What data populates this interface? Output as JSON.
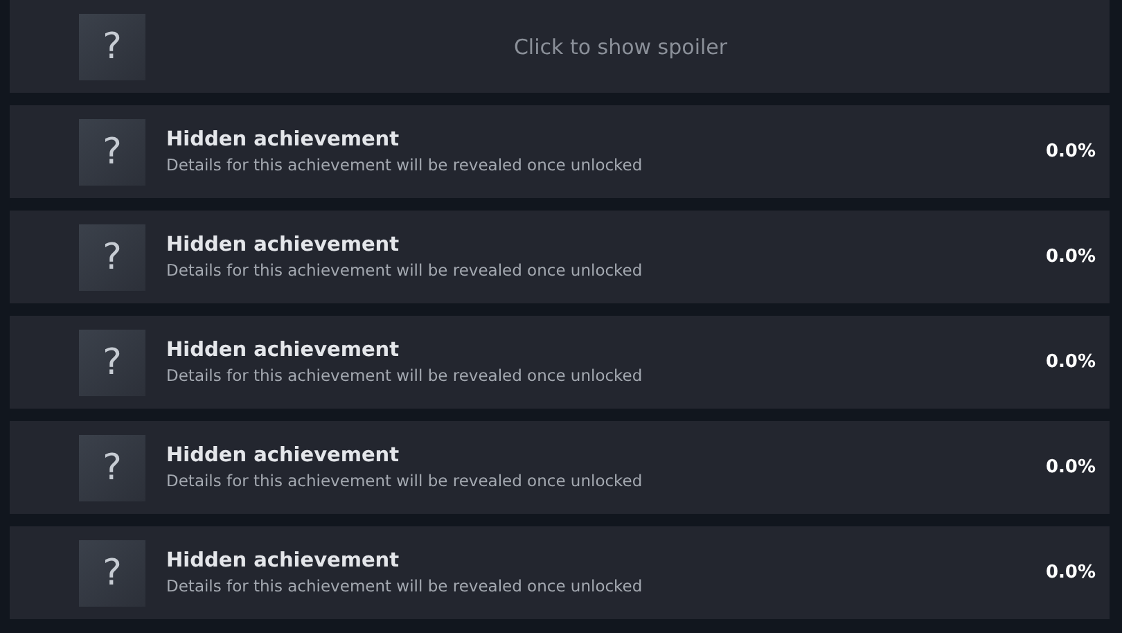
{
  "rows": [
    {
      "kind": "spoiler",
      "glyph": "?",
      "text": "Click to show spoiler"
    },
    {
      "kind": "achievement",
      "glyph": "?",
      "title": "Hidden achievement",
      "description": "Details for this achievement will be revealed once unlocked",
      "percent": "0.0%"
    },
    {
      "kind": "achievement",
      "glyph": "?",
      "title": "Hidden achievement",
      "description": "Details for this achievement will be revealed once unlocked",
      "percent": "0.0%"
    },
    {
      "kind": "achievement",
      "glyph": "?",
      "title": "Hidden achievement",
      "description": "Details for this achievement will be revealed once unlocked",
      "percent": "0.0%"
    },
    {
      "kind": "achievement",
      "glyph": "?",
      "title": "Hidden achievement",
      "description": "Details for this achievement will be revealed once unlocked",
      "percent": "0.0%"
    },
    {
      "kind": "achievement",
      "glyph": "?",
      "title": "Hidden achievement",
      "description": "Details for this achievement will be revealed once unlocked",
      "percent": "0.0%"
    }
  ]
}
